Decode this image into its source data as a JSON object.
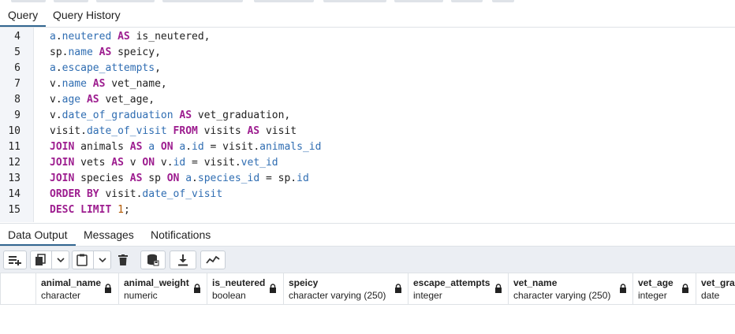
{
  "query_tabs": [
    "Query",
    "Query History"
  ],
  "editor": {
    "lines": [
      {
        "n": "4",
        "tokens": [
          [
            "pr",
            "a"
          ],
          [
            "",
            "."
          ],
          [
            "pr",
            "neutered"
          ],
          [
            "",
            " "
          ],
          [
            "kw",
            "AS"
          ],
          [
            "",
            " is_neutered,"
          ]
        ]
      },
      {
        "n": "5",
        "tokens": [
          [
            "",
            "sp."
          ],
          [
            "pr",
            "name"
          ],
          [
            "",
            " "
          ],
          [
            "kw",
            "AS"
          ],
          [
            "",
            " speicy,"
          ]
        ]
      },
      {
        "n": "6",
        "tokens": [
          [
            "pr",
            "a"
          ],
          [
            "",
            "."
          ],
          [
            "pr",
            "escape_attempts"
          ],
          [
            "",
            ","
          ]
        ]
      },
      {
        "n": "7",
        "tokens": [
          [
            "",
            "v."
          ],
          [
            "pr",
            "name"
          ],
          [
            "",
            " "
          ],
          [
            "kw",
            "AS"
          ],
          [
            "",
            " vet_name,"
          ]
        ]
      },
      {
        "n": "8",
        "tokens": [
          [
            "",
            "v."
          ],
          [
            "pr",
            "age"
          ],
          [
            "",
            " "
          ],
          [
            "kw",
            "AS"
          ],
          [
            "",
            " vet_age,"
          ]
        ]
      },
      {
        "n": "9",
        "tokens": [
          [
            "",
            "v."
          ],
          [
            "pr",
            "date_of_graduation"
          ],
          [
            "",
            " "
          ],
          [
            "kw",
            "AS"
          ],
          [
            "",
            " vet_graduation,"
          ]
        ]
      },
      {
        "n": "10",
        "tokens": [
          [
            "",
            "visit."
          ],
          [
            "pr",
            "date_of_visit"
          ],
          [
            "",
            " "
          ],
          [
            "kw",
            "FROM"
          ],
          [
            "",
            " visits "
          ],
          [
            "kw",
            "AS"
          ],
          [
            "",
            " visit"
          ]
        ]
      },
      {
        "n": "11",
        "tokens": [
          [
            "kw",
            "JOIN"
          ],
          [
            "",
            " animals "
          ],
          [
            "kw",
            "AS"
          ],
          [
            "",
            " "
          ],
          [
            "pr",
            "a"
          ],
          [
            "",
            " "
          ],
          [
            "kw",
            "ON"
          ],
          [
            "",
            " "
          ],
          [
            "pr",
            "a"
          ],
          [
            "",
            "."
          ],
          [
            "pr",
            "id"
          ],
          [
            "",
            " = visit."
          ],
          [
            "pr",
            "animals_id"
          ]
        ]
      },
      {
        "n": "12",
        "tokens": [
          [
            "kw",
            "JOIN"
          ],
          [
            "",
            " vets "
          ],
          [
            "kw",
            "AS"
          ],
          [
            "",
            " v "
          ],
          [
            "kw",
            "ON"
          ],
          [
            "",
            " v."
          ],
          [
            "pr",
            "id"
          ],
          [
            "",
            " = visit."
          ],
          [
            "pr",
            "vet_id"
          ]
        ]
      },
      {
        "n": "13",
        "tokens": [
          [
            "kw",
            "JOIN"
          ],
          [
            "",
            " species "
          ],
          [
            "kw",
            "AS"
          ],
          [
            "",
            " sp "
          ],
          [
            "kw",
            "ON"
          ],
          [
            "",
            " "
          ],
          [
            "pr",
            "a"
          ],
          [
            "",
            "."
          ],
          [
            "pr",
            "species_id"
          ],
          [
            "",
            " = sp."
          ],
          [
            "pr",
            "id"
          ]
        ]
      },
      {
        "n": "14",
        "tokens": [
          [
            "kw",
            "ORDER BY"
          ],
          [
            "",
            " visit."
          ],
          [
            "pr",
            "date_of_visit"
          ]
        ]
      },
      {
        "n": "15",
        "tokens": [
          [
            "kw",
            "DESC LIMIT"
          ],
          [
            "",
            " "
          ],
          [
            "nm",
            "1"
          ],
          [
            "",
            ";"
          ]
        ]
      }
    ]
  },
  "output_tabs": [
    "Data Output",
    "Messages",
    "Notifications"
  ],
  "toolbar_icons": [
    "add-row-icon",
    "copy-icon",
    "chevron-down-icon",
    "paste-icon",
    "chevron-down-icon",
    "delete-icon",
    "save-data-icon",
    "download-icon",
    "graph-icon"
  ],
  "columns": [
    {
      "name": "animal_name",
      "type": "character"
    },
    {
      "name": "animal_weight",
      "type": "numeric"
    },
    {
      "name": "is_neutered",
      "type": "boolean"
    },
    {
      "name": "speicy",
      "type": "character varying (250)"
    },
    {
      "name": "escape_attempts",
      "type": "integer"
    },
    {
      "name": "vet_name",
      "type": "character varying (250)"
    },
    {
      "name": "vet_age",
      "type": "integer"
    },
    {
      "name": "vet_grad",
      "type": "date"
    }
  ],
  "colors": {
    "keyword": "#9d1d8f",
    "property": "#2f6db2",
    "number": "#b35900",
    "active_tab": "#326690"
  }
}
